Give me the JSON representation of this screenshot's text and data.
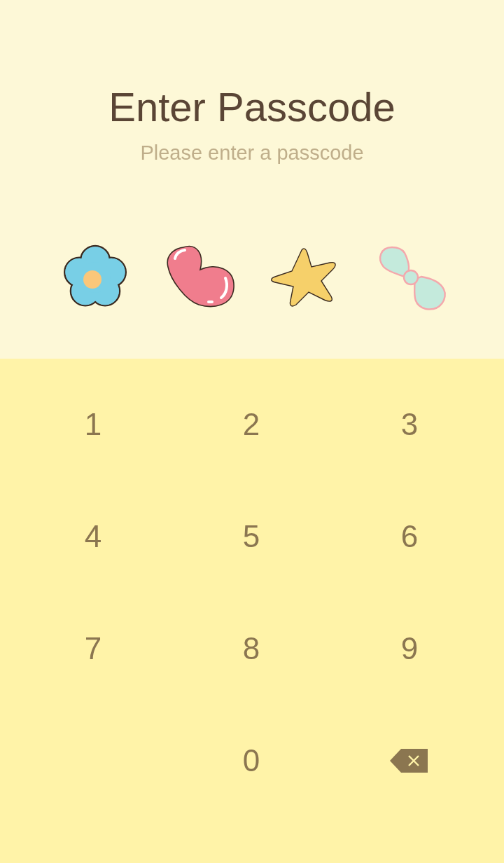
{
  "title": "Enter Passcode",
  "subtitle": "Please enter a passcode",
  "slots": [
    {
      "kind": "flower",
      "filled": true
    },
    {
      "kind": "heart",
      "filled": true
    },
    {
      "kind": "star",
      "filled": true
    },
    {
      "kind": "bow",
      "filled": false
    }
  ],
  "keys": [
    {
      "kind": "digit",
      "label": "1"
    },
    {
      "kind": "digit",
      "label": "2"
    },
    {
      "kind": "digit",
      "label": "3"
    },
    {
      "kind": "digit",
      "label": "4"
    },
    {
      "kind": "digit",
      "label": "5"
    },
    {
      "kind": "digit",
      "label": "6"
    },
    {
      "kind": "digit",
      "label": "7"
    },
    {
      "kind": "digit",
      "label": "8"
    },
    {
      "kind": "digit",
      "label": "9"
    },
    {
      "kind": "blank"
    },
    {
      "kind": "digit",
      "label": "0"
    },
    {
      "kind": "backspace"
    }
  ]
}
